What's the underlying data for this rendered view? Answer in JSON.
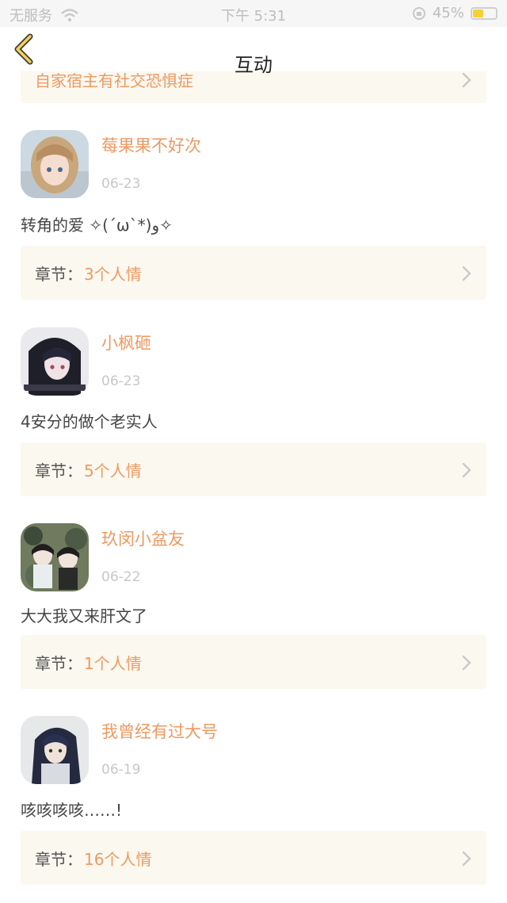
{
  "status_bar": {
    "carrier": "无服务",
    "time": "下午 5:31",
    "battery_text": "45%",
    "battery_level": 0.45
  },
  "nav": {
    "title": "互动"
  },
  "partial_card": {
    "text": "自家宿主有社交恐惧症"
  },
  "chapter_prefix": "章节：",
  "items": [
    {
      "name": "莓果果不好次",
      "date": "06-23",
      "comment": "转角的爱 ✧(´ω`*)و✧",
      "chapter": "3个人情"
    },
    {
      "name": "小枫砸",
      "date": "06-23",
      "comment": "4安分的做个老实人",
      "chapter": "5个人情"
    },
    {
      "name": "玖闵小盆友",
      "date": "06-22",
      "comment": "大大我又来肝文了",
      "chapter": "1个人情"
    },
    {
      "name": "我曾经有过大号",
      "date": "06-19",
      "comment": "咳咳咳咳……!",
      "chapter": "16个人情"
    }
  ]
}
